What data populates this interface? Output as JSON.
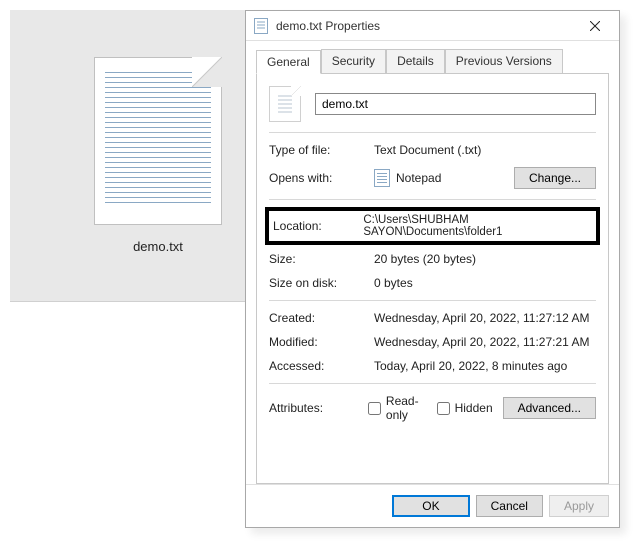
{
  "preview": {
    "filename": "demo.txt"
  },
  "dialog": {
    "title": "demo.txt Properties",
    "tabs": {
      "general": "General",
      "security": "Security",
      "details": "Details",
      "previous": "Previous Versions"
    },
    "filename_value": "demo.txt",
    "type_label": "Type of file:",
    "type_value": "Text Document (.txt)",
    "opens_label": "Opens with:",
    "opens_app": "Notepad",
    "change_btn": "Change...",
    "location_label": "Location:",
    "location_value": "C:\\Users\\SHUBHAM SAYON\\Documents\\folder1",
    "size_label": "Size:",
    "size_value": "20 bytes (20 bytes)",
    "sod_label": "Size on disk:",
    "sod_value": "0 bytes",
    "created_label": "Created:",
    "created_value": "Wednesday, April 20, 2022, 11:27:12 AM",
    "modified_label": "Modified:",
    "modified_value": "Wednesday, April 20, 2022, 11:27:21 AM",
    "accessed_label": "Accessed:",
    "accessed_value": "Today, April 20, 2022, 8 minutes ago",
    "attributes_label": "Attributes:",
    "readonly_label": "Read-only",
    "hidden_label": "Hidden",
    "advanced_btn": "Advanced...",
    "ok": "OK",
    "cancel": "Cancel",
    "apply": "Apply"
  }
}
